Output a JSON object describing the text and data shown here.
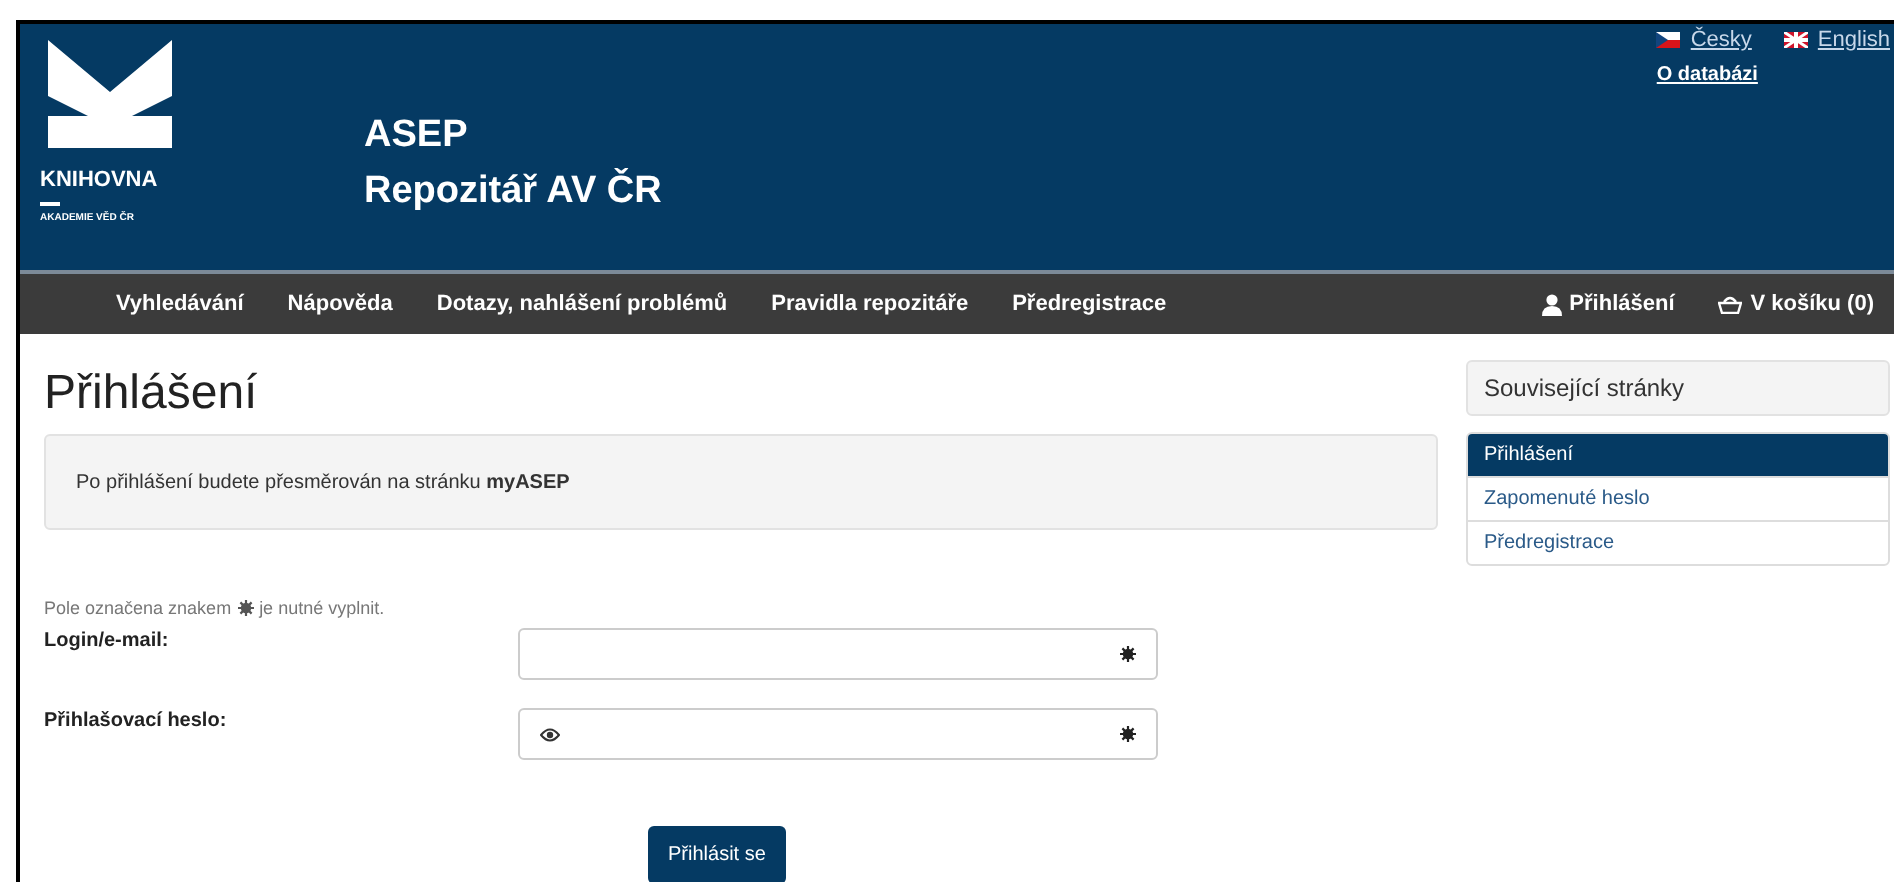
{
  "header": {
    "logo": {
      "wordmark": "KNIHOVNA",
      "subtitle": "AKADEMIE VĚD ČR"
    },
    "title_lines": [
      "ASEP",
      "Repozitář AV ČR"
    ],
    "languages": [
      {
        "label": "Česky",
        "kind": "cz"
      },
      {
        "label": "English",
        "kind": "uk"
      }
    ],
    "links": [
      "O databázi"
    ]
  },
  "nav": {
    "items": [
      "Vyhledávání",
      "Nápověda",
      "Dotazy, nahlášení problémů",
      "Pravidla repozitáře",
      "Předregistrace"
    ],
    "right": [
      {
        "label": "Přihlášení",
        "kind": "user"
      },
      {
        "label": "V košíku (0)",
        "kind": "basket"
      }
    ]
  },
  "page_title": "Přihlášení",
  "notice": "Po přihlášení budete přesměrován na stránku **myASEP**",
  "required_note": {
    "before": "Pole označena znakem",
    "after": "je nutné vyplnit."
  },
  "fields": [
    {
      "label": "Login/e-mail:",
      "kind": "text",
      "required": true
    },
    {
      "label": "Přihlašovací heslo:",
      "kind": "password",
      "required": true
    }
  ],
  "submit": "Přihlásit se",
  "sidebar": {
    "title": "Související stránky",
    "items": [
      {
        "label": "Přihlášení",
        "selected": true
      },
      {
        "label": "Zapomenuté heslo",
        "selected": false
      },
      {
        "label": "Předregistrace",
        "selected": false
      }
    ]
  }
}
